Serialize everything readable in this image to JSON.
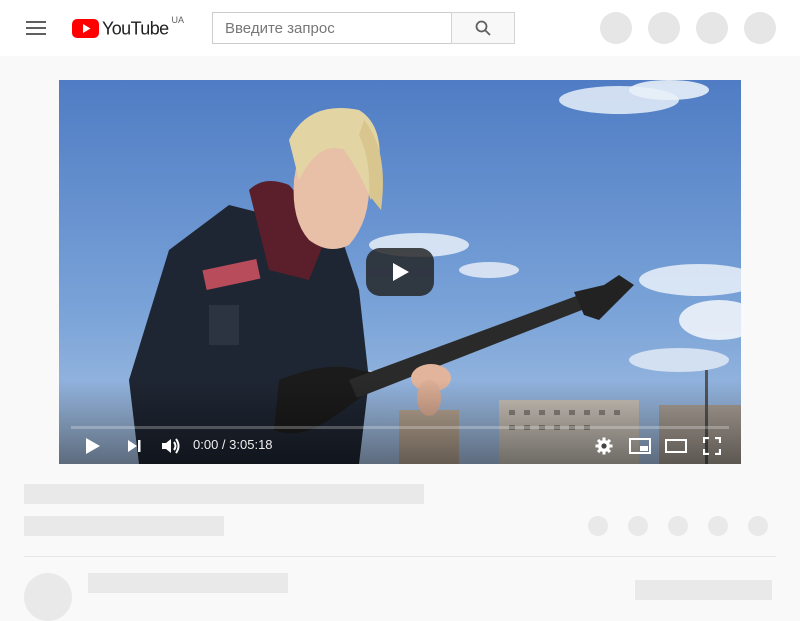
{
  "header": {
    "logo_text": "YouTube",
    "country_code": "UA",
    "search_placeholder": "Введите запрос"
  },
  "player": {
    "current_time": "0:00",
    "separator": " / ",
    "duration": "3:05:18",
    "progress_percent": 0
  },
  "colors": {
    "brand_red": "#ff0000",
    "skeleton": "#e9e9e9"
  },
  "icons": {
    "menu": "hamburger-icon",
    "search": "magnifier-icon",
    "play": "play-icon",
    "next": "skip-next-icon",
    "volume": "speaker-icon",
    "settings": "gear-icon",
    "miniplayer": "miniplayer-icon",
    "theater": "theater-mode-icon",
    "fullscreen": "fullscreen-icon"
  }
}
